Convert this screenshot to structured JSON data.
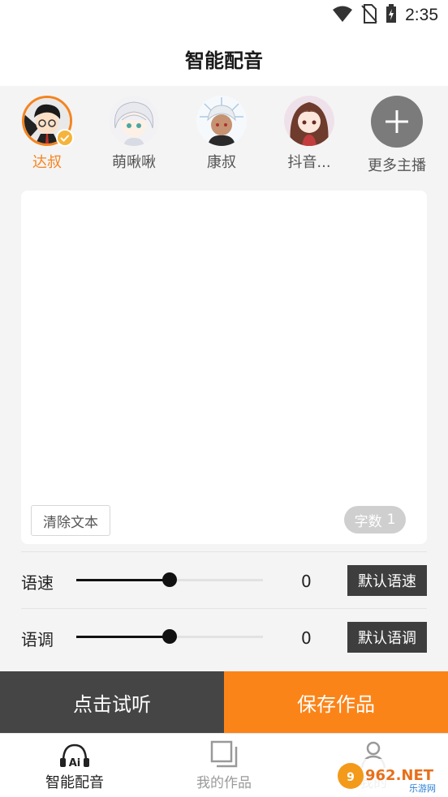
{
  "status_bar": {
    "time": "2:35",
    "icons": [
      "wifi-icon",
      "no-sim-icon",
      "battery-charging-icon"
    ]
  },
  "header": {
    "title": "智能配音"
  },
  "anchors": [
    {
      "name": "达叔",
      "selected": true,
      "avatar": "avatar-dashu"
    },
    {
      "name": "萌啾啾",
      "selected": false,
      "avatar": "avatar-mengjiujiu"
    },
    {
      "name": "康叔",
      "selected": false,
      "avatar": "avatar-kangshu"
    },
    {
      "name": "抖音...",
      "selected": false,
      "avatar": "avatar-douyin"
    }
  ],
  "more_anchors": {
    "label": "更多主播",
    "icon": "plus-icon"
  },
  "editor": {
    "text": "",
    "clear_label": "清除文本",
    "count_label": "字数",
    "count_value": "1"
  },
  "speed": {
    "label": "语速",
    "value": "0",
    "default_label": "默认语速",
    "level": 0.5
  },
  "pitch": {
    "label": "语调",
    "value": "0",
    "default_label": "默认语调",
    "level": 0.5
  },
  "actions": {
    "listen_label": "点击试听",
    "save_label": "保存作品"
  },
  "tabbar": {
    "tabs": [
      {
        "label": "智能配音",
        "icon": "ai-headset-icon",
        "active": true
      },
      {
        "label": "我的作品",
        "icon": "works-icon",
        "active": false
      },
      {
        "label": "我的",
        "icon": "profile-icon",
        "active": false
      }
    ]
  },
  "watermark": {
    "text": "962.NET",
    "subtext": "乐游网"
  },
  "colors": {
    "accent": "#fb8418",
    "dark_button": "#454545",
    "default_button": "#3e3e3e",
    "selected_text": "#f5841f"
  }
}
